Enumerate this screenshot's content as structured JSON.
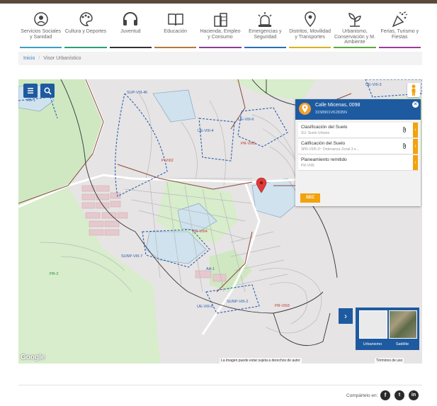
{
  "colors": {
    "brand_blue": "#1e5aa0",
    "accent_orange": "#f2a20d",
    "link_blue": "#3a7bbf"
  },
  "nav": [
    {
      "label": "Servicios Sociales y Sanidad",
      "icon": "people-care-icon",
      "color": "#3aa0c8"
    },
    {
      "label": "Cultura y Deportes",
      "icon": "palette-icon",
      "color": "#2b9e7a"
    },
    {
      "label": "Juventud",
      "icon": "headphones-icon",
      "color": "#333333"
    },
    {
      "label": "Educación",
      "icon": "book-icon",
      "color": "#b07a3c"
    },
    {
      "label": "Hacienda, Empleo y Consumo",
      "icon": "coins-icon",
      "color": "#8a3f8f"
    },
    {
      "label": "Emergencias y Seguridad",
      "icon": "siren-icon",
      "color": "#2b6fb5"
    },
    {
      "label": "Distritos, Movilidad y Transportes",
      "icon": "location-icon",
      "color": "#d9b21f"
    },
    {
      "label": "Urbanismo, Conservación y M. Ambiente",
      "icon": "plant-icon",
      "color": "#5aaa3c"
    },
    {
      "label": "Ferias, Turismo y Fiestas",
      "icon": "party-icon",
      "color": "#9b3d9a"
    }
  ],
  "breadcrumb": {
    "home": "Inicio",
    "current": "Visor Urbanístico"
  },
  "map": {
    "zone_labels": [
      "SUP-VIII-4ll",
      "UE-VIII-3",
      "UE-VIII-4",
      "UE-VIII-6",
      "PR-VIII5",
      "P-VIII2",
      "PR-VIII4",
      "SUNP-VIII-7",
      "AA-1",
      "UE-VIII-6",
      "SUNP-VIII-2",
      "PR-VIII3",
      "PR-2",
      "AA-1"
    ],
    "controls": {
      "menu": "menu-icon",
      "search": "search-icon",
      "pegman": "pegman-icon"
    },
    "attribution": "La imagen puede estar sujeta a derechos de autor",
    "terms": "Términos de uso",
    "google": "Google"
  },
  "popup": {
    "address": "Calle Micenas, 0098",
    "reference": "3158901VK2835N",
    "rows": [
      {
        "title": "Clasificación del Suelo",
        "sub": "SU: Suelo Urbano"
      },
      {
        "title": "Calificación del Suelo",
        "sub": "3PR-VIII5-3º: Ordenanza Zonal 3 e..."
      },
      {
        "title": "Planeamiento remitido",
        "sub": "PR-VIII5"
      }
    ],
    "sec_button": "SEC"
  },
  "layers": {
    "urbanismo": "Urbanismo",
    "satelite": "Satélite"
  },
  "footer": {
    "share_label": "Compártelo en:",
    "networks": [
      "f",
      "t",
      "in"
    ]
  }
}
